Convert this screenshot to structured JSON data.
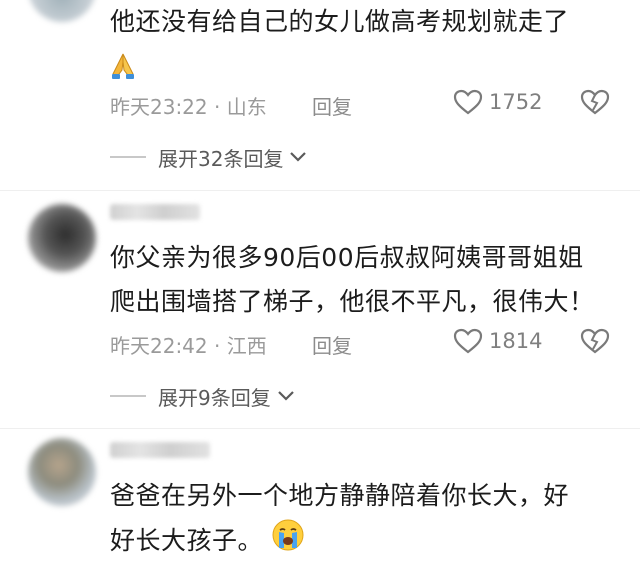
{
  "comments": [
    {
      "text_line1": "他还没有给自己的女儿做高考规划就走了",
      "emoji": "folded-hands",
      "time": "昨天23:22 · 山东",
      "reply_label": "回复",
      "likes": "1752",
      "expand_label": "展开32条回复"
    },
    {
      "text_line1": "你父亲为很多90后00后叔叔阿姨哥哥姐姐",
      "text_line2": "爬出围墙搭了梯子，他很不平凡，很伟大！",
      "time": "昨天22:42 · 江西",
      "reply_label": "回复",
      "likes": "1814",
      "expand_label": "展开9条回复"
    },
    {
      "text_line1": "爸爸在另外一个地方静静陪着你长大，好",
      "text_line2": "好长大孩子。",
      "emoji": "crying-face"
    }
  ]
}
